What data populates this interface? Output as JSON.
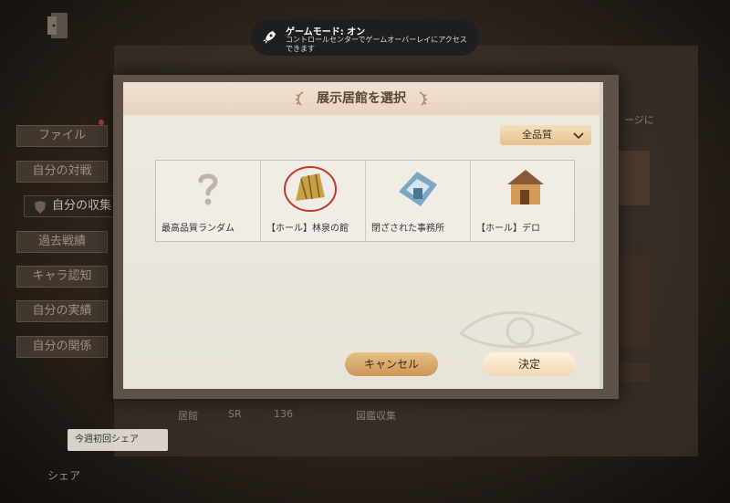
{
  "toast": {
    "title": "ゲームモード: オン",
    "body": "コントロールセンターでゲームオーバーレイにアクセスできます"
  },
  "sidebar": {
    "items": [
      {
        "label": "ファイル"
      },
      {
        "label": "自分の対戦"
      },
      {
        "label": "自分の収集"
      },
      {
        "label": "過去戦績"
      },
      {
        "label": "キャラ認知"
      },
      {
        "label": "自分の実績"
      },
      {
        "label": "自分の関係"
      }
    ]
  },
  "share": {
    "badge": "今週初回シェア",
    "label": "シェア"
  },
  "background_row": {
    "col1": "居館",
    "col2": "SR",
    "col3": "136",
    "col4": "図鑑収集"
  },
  "right_text": "ージに",
  "modal": {
    "title": "展示居館を選択",
    "filter": "全品質",
    "cards": [
      {
        "label": "最高品質ランダム",
        "icon": "question-mark-icon"
      },
      {
        "label": "【ホール】林泉の館",
        "icon": "golden-gate-icon"
      },
      {
        "label": "閉ざされた事務所",
        "icon": "office-icon"
      },
      {
        "label": "【ホール】デロ",
        "icon": "hall-icon"
      }
    ],
    "cancel": "キャンセル",
    "confirm": "決定"
  },
  "colors": {
    "accent": "#c99657",
    "title_bg": "#e8d4c0"
  }
}
